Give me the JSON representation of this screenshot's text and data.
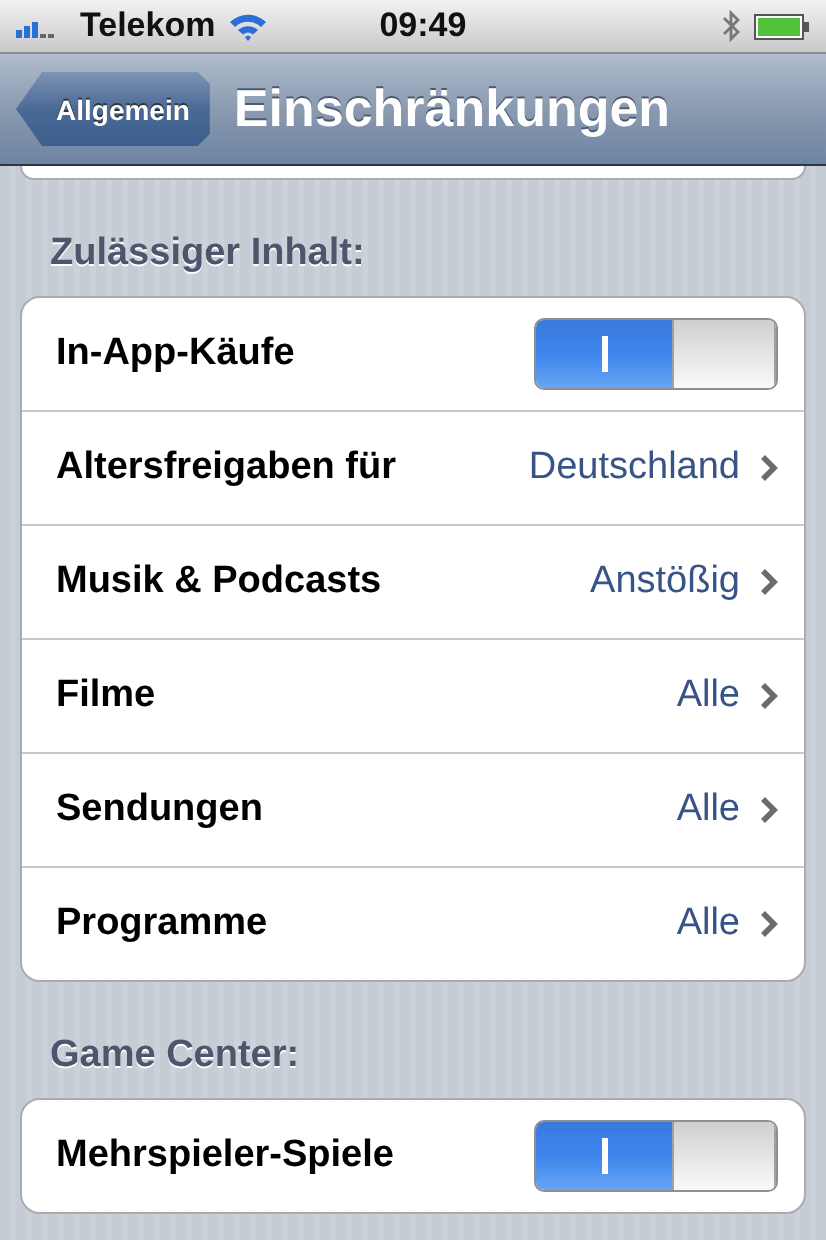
{
  "status_bar": {
    "carrier": "Telekom",
    "time": "09:49"
  },
  "nav_bar": {
    "back_button": "Allgemein",
    "title": "Einschränkungen"
  },
  "sections": [
    {
      "header": "Zulässiger Inhalt:",
      "rows": [
        {
          "kind": "toggle",
          "label": "In-App-Käufe",
          "on": true
        },
        {
          "kind": "detail",
          "label": "Altersfreigaben für",
          "value": "Deutschland"
        },
        {
          "kind": "detail",
          "label": "Musik & Podcasts",
          "value": "Anstößig"
        },
        {
          "kind": "detail",
          "label": "Filme",
          "value": "Alle"
        },
        {
          "kind": "detail",
          "label": "Sendungen",
          "value": "Alle"
        },
        {
          "kind": "detail",
          "label": "Programme",
          "value": "Alle"
        }
      ]
    },
    {
      "header": "Game Center:",
      "rows": [
        {
          "kind": "toggle",
          "label": "Mehrspieler-Spiele",
          "on": true
        }
      ]
    }
  ]
}
